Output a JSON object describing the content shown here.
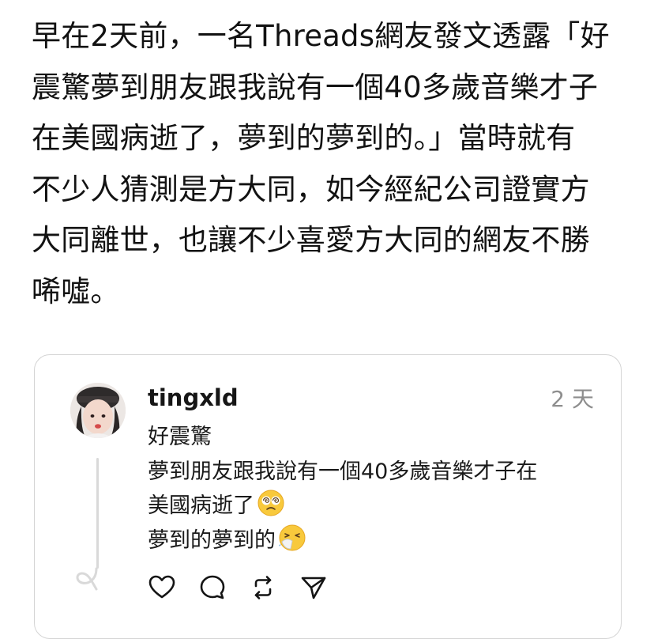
{
  "article": {
    "lines": [
      "早在2天前，一名Threads網友發文透露「好",
      "震驚夢到朋友跟我說有一個40多歲音樂才子",
      "在美國病逝了，夢到的夢到的。」當時就有",
      "不少人猜測是方大同，如今經紀公司證實方",
      "大同離世，也讓不少喜愛方大同的網友不勝",
      "唏噓。"
    ]
  },
  "post": {
    "username": "tingxld",
    "timestamp": "2 天",
    "lines": [
      "好震驚",
      "夢到朋友跟我說有一個40多歲音樂才子在",
      "美國病逝了",
      "夢到的夢到的"
    ],
    "emojis": [
      "dizzy-face-emoji",
      "sneezing-face-emoji"
    ],
    "actions": [
      "like-heart-icon",
      "comment-bubble-icon",
      "repost-icon",
      "share-send-icon"
    ]
  }
}
